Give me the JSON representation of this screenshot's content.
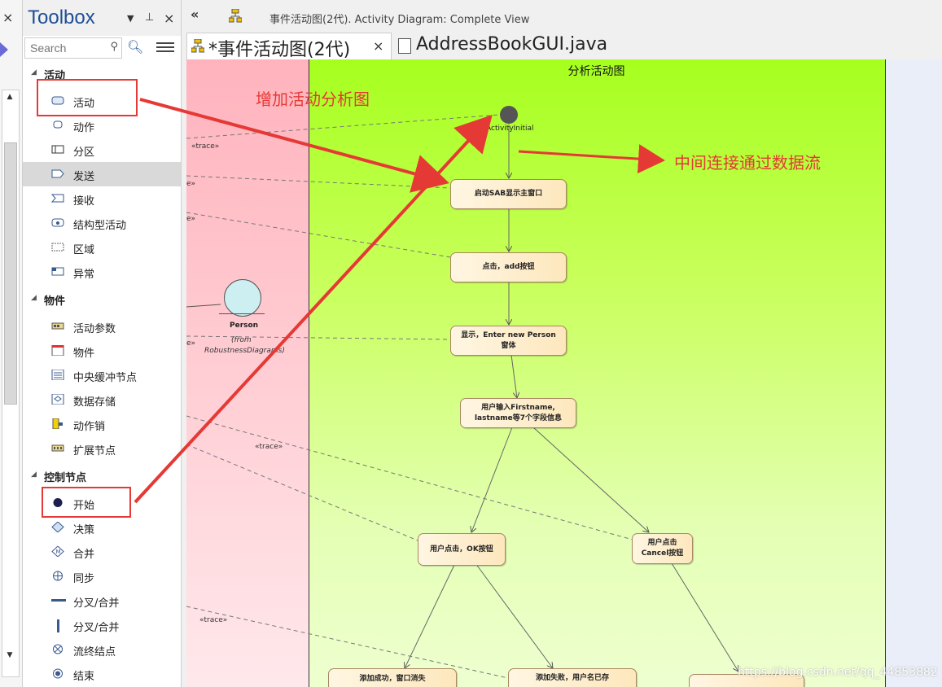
{
  "left_strip": {
    "close_glyph": "×",
    "scroll_up": "▲",
    "scroll_down": "▼"
  },
  "toolbox": {
    "title": "Toolbox",
    "pin_menu_glyph": "▼",
    "pin_glyph": "⊥",
    "close_glyph": "×",
    "search_placeholder": "Search",
    "categories": [
      {
        "label": "活动",
        "items": [
          {
            "label": "活动",
            "icon": "activity-icon"
          },
          {
            "label": "动作",
            "icon": "action-icon"
          },
          {
            "label": "分区",
            "icon": "partition-icon"
          },
          {
            "label": "发送",
            "icon": "send-icon"
          },
          {
            "label": "接收",
            "icon": "receive-icon"
          },
          {
            "label": "结构型活动",
            "icon": "structured-activity-icon"
          },
          {
            "label": "区域",
            "icon": "region-icon"
          },
          {
            "label": "异常",
            "icon": "exception-icon"
          }
        ]
      },
      {
        "label": "物件",
        "items": [
          {
            "label": "活动参数",
            "icon": "activity-parameter-icon"
          },
          {
            "label": "物件",
            "icon": "object-icon"
          },
          {
            "label": "中央缓冲节点",
            "icon": "central-buffer-icon"
          },
          {
            "label": "数据存储",
            "icon": "datastore-icon"
          },
          {
            "label": "动作销",
            "icon": "action-pin-icon"
          },
          {
            "label": "扩展节点",
            "icon": "expansion-node-icon"
          }
        ]
      },
      {
        "label": "控制节点",
        "items": [
          {
            "label": "开始",
            "icon": "initial-icon"
          },
          {
            "label": "决策",
            "icon": "decision-icon"
          },
          {
            "label": "合并",
            "icon": "merge-icon"
          },
          {
            "label": "同步",
            "icon": "synch-icon"
          },
          {
            "label": "分叉/合并",
            "icon": "fork-join-horizontal-icon"
          },
          {
            "label": "分叉/合并",
            "icon": "fork-join-vertical-icon"
          },
          {
            "label": "流终结点",
            "icon": "flow-final-icon"
          },
          {
            "label": "结束",
            "icon": "final-icon"
          }
        ]
      }
    ],
    "selected_item": "发送"
  },
  "header": {
    "collapse_glyph": "«",
    "diagram_title": "事件活动图(2代).  Activity Diagram: Complete View"
  },
  "tabs": [
    {
      "label": "*事件活动图(2代)",
      "close_glyph": "×",
      "active": true
    },
    {
      "label": "AddressBookGUI.java",
      "active": false
    }
  ],
  "diagram": {
    "lane_title": "分析活动图",
    "initial_label": "ActivityInitial",
    "nodes": [
      "启动SAB显示主窗口",
      "点击，add按钮",
      "显示，Enter new Person 窗体",
      "用户输入Firstname, lastname等7个字段信息",
      "用户点击，OK按钮",
      "用户点击 Cancel按钮",
      "添加成功，窗口消失",
      "添加失败，用户名已存"
    ],
    "node_lines": {
      "n3": [
        "显示，Enter new Person",
        "窗体"
      ],
      "n4": [
        "用户输入Firstname,",
        "lastname等7个字段信息"
      ],
      "n6": [
        "用户点击",
        "Cancel按钮"
      ]
    },
    "person": {
      "name": "Person",
      "from_line1": "(from",
      "from_line2": "RobustnessDiagrams)"
    },
    "trace_label": "«trace»",
    "trace_partial": "e»",
    "annotations": {
      "add_activity": "增加活动分析图",
      "data_flow": "中间连接通过数据流"
    },
    "watermark": "https://blog.csdn.net/qq_44853882"
  },
  "colors": {
    "annotation_red": "#e53935",
    "lane_green": "#a6ff1e",
    "lane_pink": "#ffb3bd",
    "toolbox_title": "#1f4e96"
  }
}
